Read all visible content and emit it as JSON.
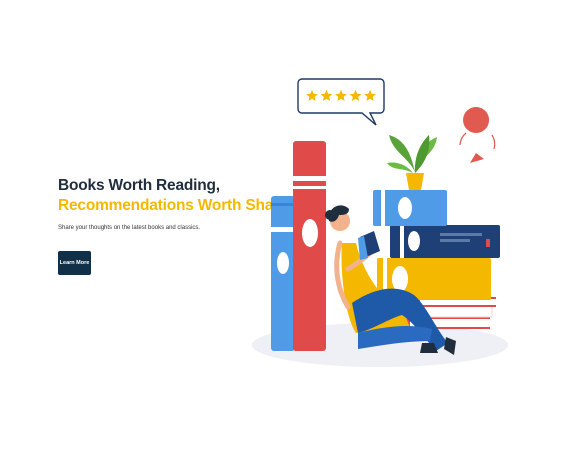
{
  "hero": {
    "title_line1": "Books Worth Reading,",
    "title_line2": "Recommendations Worth Sharing.",
    "subtitle": "Share your thoughts on the latest books and classics.",
    "cta_label": "Learn More"
  },
  "illustration": {
    "rating_stars": 5,
    "icons": [
      "star-icon",
      "heart-icon"
    ]
  },
  "colors": {
    "heading": "#1f2d3d",
    "accent": "#f5b800",
    "button": "#10304a"
  }
}
